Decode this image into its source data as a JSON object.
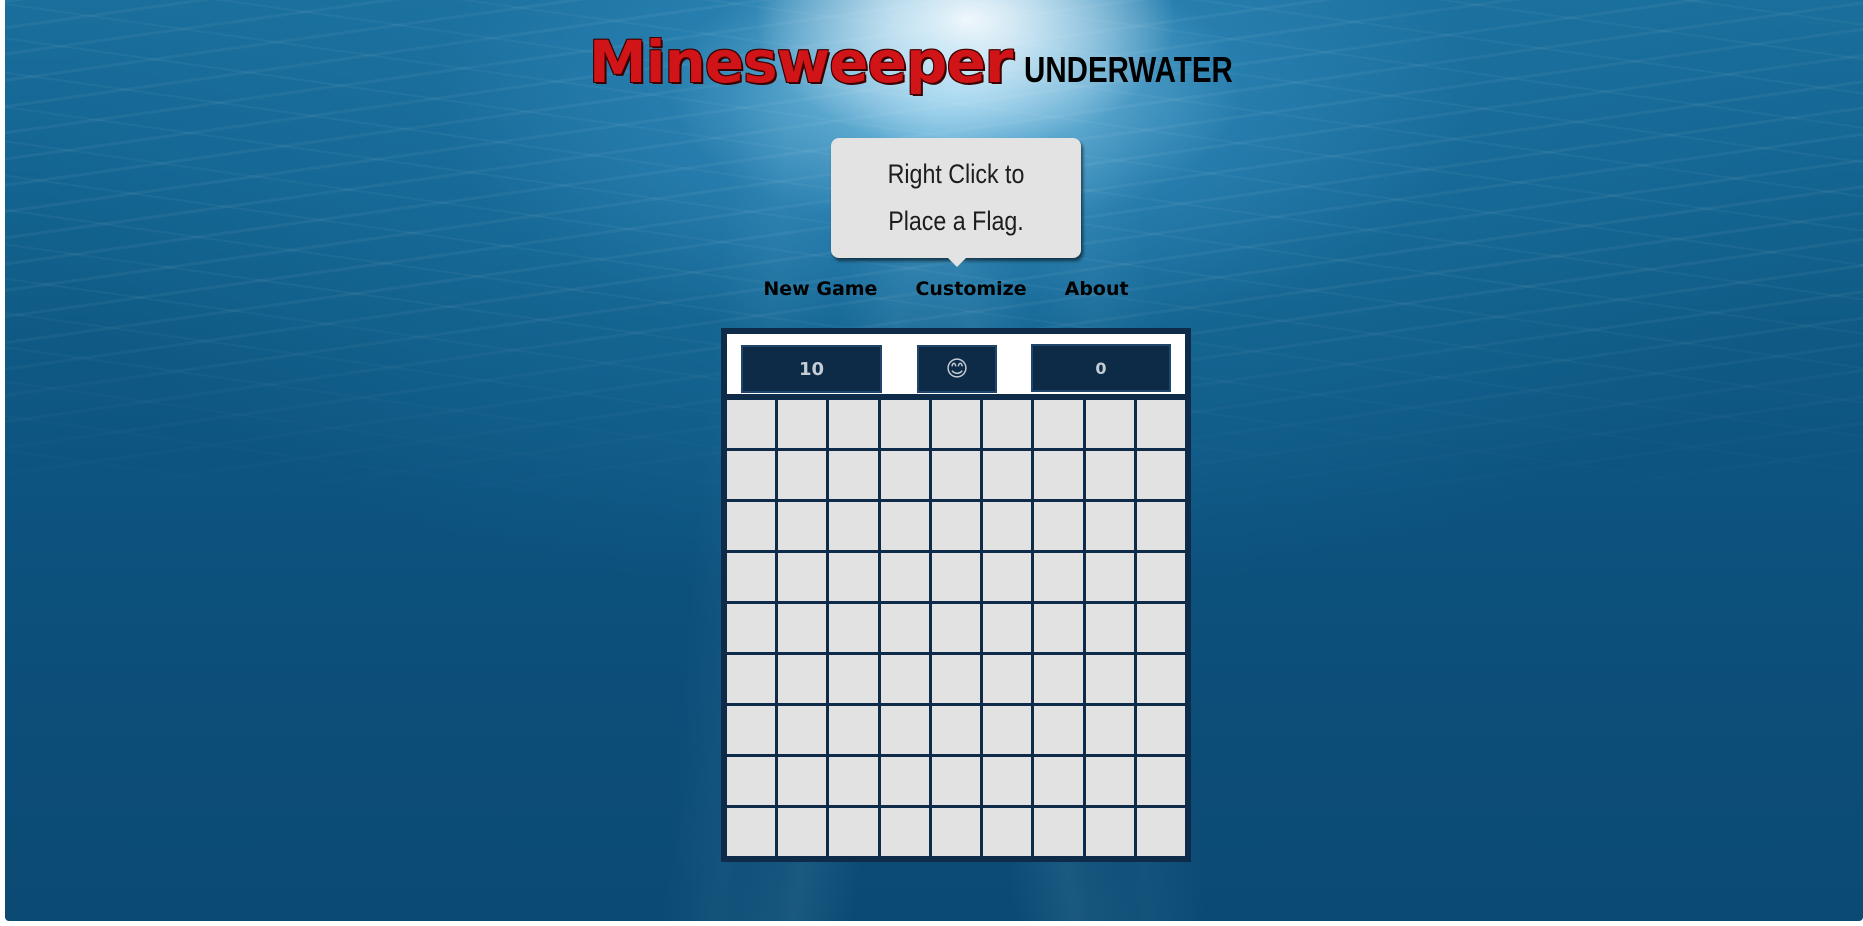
{
  "header": {
    "title_main": "Minesweeper",
    "title_sub": "UNDERWATER"
  },
  "tooltip": {
    "text": "Right Click to Place a Flag."
  },
  "nav": {
    "items": [
      "New Game",
      "Customize",
      "About"
    ]
  },
  "board": {
    "mines_remaining": "10",
    "face_icon": "😊",
    "timer": "0",
    "rows": 9,
    "cols": 9,
    "cell_state": "unrevealed"
  },
  "colors": {
    "title_red": "#d01417",
    "board_navy": "#0e2b4a",
    "cell_gray": "#e2e2e2",
    "water_blue": "#0f5b85"
  }
}
